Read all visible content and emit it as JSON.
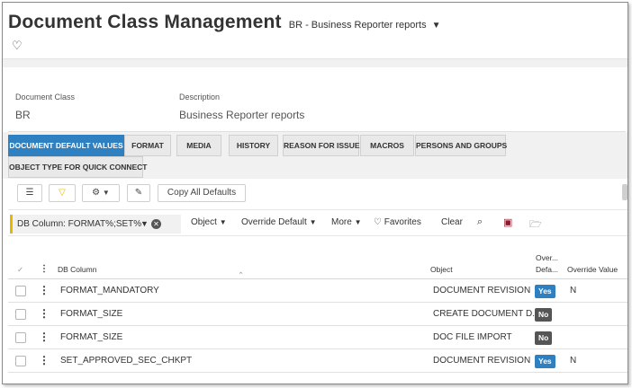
{
  "header": {
    "title": "Document Class Management",
    "context": "BR - Business Reporter reports"
  },
  "fields": {
    "doc_class_label": "Document Class",
    "doc_class_value": "BR",
    "description_label": "Description",
    "description_value": "Business Reporter reports"
  },
  "tabs": [
    {
      "label": "DOCUMENT DEFAULT VALUES",
      "active": true
    },
    {
      "label": "FORMAT"
    },
    {
      "label": "MEDIA"
    },
    {
      "label": "HISTORY"
    },
    {
      "label": "REASON FOR ISSUE"
    },
    {
      "label": "MACROS"
    },
    {
      "label": "PERSONS AND GROUPS"
    },
    {
      "label": "OBJECT TYPE FOR QUICK CONNECT"
    }
  ],
  "toolbar": {
    "copy_all_defaults": "Copy All Defaults"
  },
  "filter": {
    "chip": "DB Column: FORMAT%;SET%",
    "object": "Object",
    "override_default": "Override Default",
    "more": "More",
    "favorites": "Favorites",
    "clear": "Clear"
  },
  "grid": {
    "col_db_column": "DB Column",
    "col_object": "Object",
    "col_override_default_top": "Over...",
    "col_override_default_bottom": "Defa...",
    "col_override_value": "Override Value",
    "rows": [
      {
        "db_column": "FORMAT_MANDATORY",
        "object": "DOCUMENT REVISION",
        "override_default": "Yes",
        "override_value": "N"
      },
      {
        "db_column": "FORMAT_SIZE",
        "object": "CREATE DOCUMENT D...",
        "override_default": "No",
        "override_value": ""
      },
      {
        "db_column": "FORMAT_SIZE",
        "object": "DOC FILE IMPORT",
        "override_default": "No",
        "override_value": ""
      },
      {
        "db_column": "SET_APPROVED_SEC_CHKPT",
        "object": "DOCUMENT REVISION",
        "override_default": "Yes",
        "override_value": "N"
      }
    ]
  },
  "icons": {
    "favorite": "heart-icon",
    "context_dropdown": "caret-down-icon"
  },
  "colors": {
    "accent": "#2f80c1",
    "filter_chip_marker": "#e6b800",
    "badge_no": "#555555"
  }
}
